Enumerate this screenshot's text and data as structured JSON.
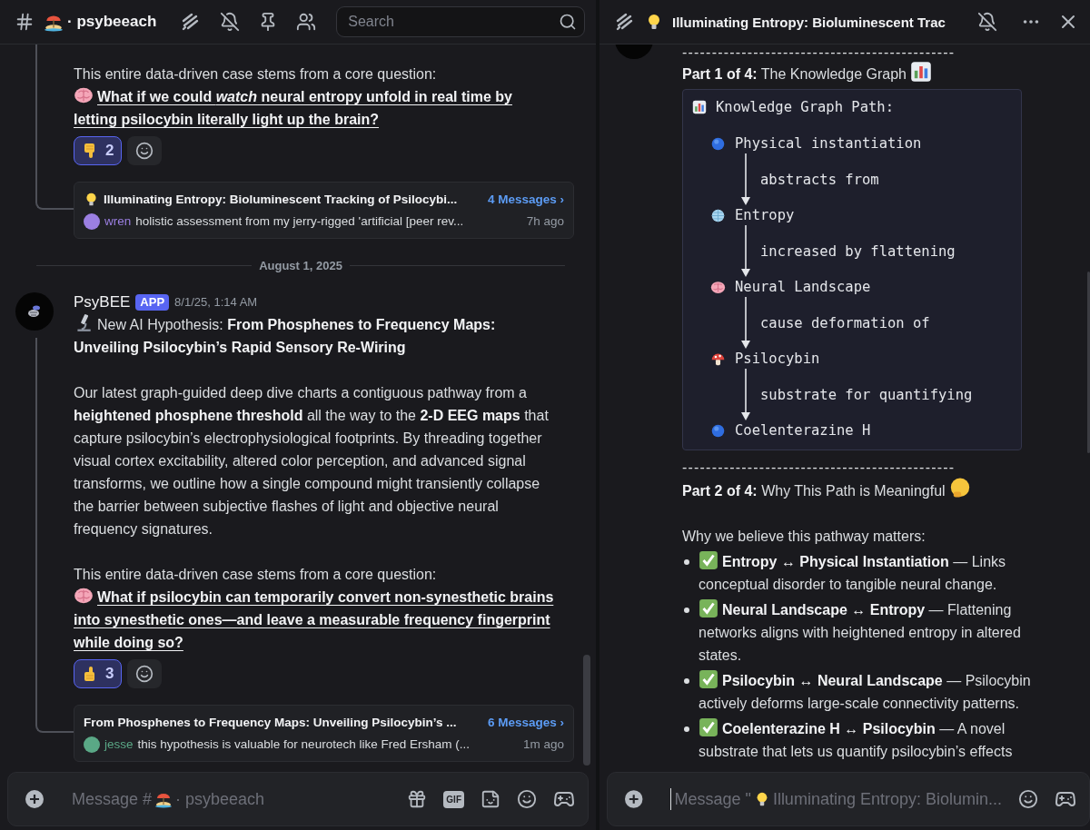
{
  "left": {
    "header": {
      "channel": "· psybeeach",
      "search": {
        "placeholder": "Search"
      }
    },
    "blocks": [
      {
        "kind": "continuation",
        "intro": "This entire data-driven case stems from a core question:",
        "question": "What if we could *watch* neural entropy unfold in real time by letting psilocybin literally light up the brain?",
        "reaction": {
          "kind": "thumbs_down",
          "count": "2",
          "selected": true
        },
        "thread": {
          "title": "Illuminating Entropy: Bioluminescent Tracking of Psilocybi...",
          "count": "4 Messages ›",
          "author": "wren",
          "color": "#9b7fe2",
          "preview": "holistic assessment from my jerry-rigged 'artificial [peer rev...",
          "time": "7h ago"
        }
      },
      {
        "kind": "divider",
        "label": "August 1, 2025"
      },
      {
        "kind": "message",
        "author": "PsyBEE",
        "tag": "APP",
        "time": "8/1/25, 1:14 AM",
        "headline": "New AI Hypothesis: **From Phosphenes to Frequency Maps: Unveiling Psilocybin’s Rapid Sensory Re-Wiring**",
        "body": "Our latest graph-guided deep dive charts a contiguous pathway from a **heightened phosphene threshold** all the way to the **2-D EEG maps** that capture psilocybin’s electrophysiological footprints. By threading together visual cortex excitability, altered color perception, and advanced signal transforms, we outline how a single compound might transiently collapse the barrier between subjective flashes of light and objective neural frequency signatures.",
        "intro": "This entire data-driven case stems from a core question:",
        "question": "What if psilocybin can temporarily convert non-synesthetic brains into synesthetic ones—and leave a measurable frequency fingerprint while doing so?",
        "reaction": {
          "kind": "thumbs_up",
          "count": "3",
          "selected": true
        },
        "thread": {
          "title": "From Phosphenes to Frequency Maps: Unveiling Psilocybin’s ...",
          "count": "6 Messages ›",
          "author": "jesse",
          "color": "#5aa886",
          "preview": "this hypothesis is valuable for neurotech like Fred Ersham (...",
          "time": "1m ago"
        }
      }
    ],
    "composer": {
      "prefix": "Message #",
      "suffix": "· psybeeach",
      "gif": "GIF"
    }
  },
  "right": {
    "header": {
      "title": "Illuminating Entropy: Bioluminescent Trac"
    },
    "content": [
      {
        "kind": "rule",
        "text": "----------------------------------------------"
      },
      {
        "kind": "heading",
        "text": "**Part 1 of 4:** The Knowledge Graph"
      },
      {
        "kind": "graph",
        "title": "Knowledge Graph Path:",
        "nodes": [
          {
            "kind": "blue_circle",
            "label": "Physical instantiation",
            "edge": "abstracts from"
          },
          {
            "kind": "globe",
            "label": "Entropy",
            "edge": "increased by flattening"
          },
          {
            "kind": "brain",
            "label": "Neural Landscape",
            "edge": "cause deformation of"
          },
          {
            "kind": "mushroom",
            "label": "Psilocybin",
            "edge": "substrate for quantifying"
          },
          {
            "kind": "blue_circle",
            "label": "Coelenterazine H"
          }
        ]
      },
      {
        "kind": "rule",
        "text": "----------------------------------------------"
      },
      {
        "kind": "heading",
        "text": "**Part 2 of 4:** Why This Path is Meaningful"
      },
      {
        "kind": "paragraph",
        "text": "Why we believe this pathway matters:"
      },
      {
        "kind": "bullets",
        "items": [
          {
            "text": "**Entropy ↔ Physical Instantiation** — Links conceptual disorder to tangible neural change."
          },
          {
            "text": "**Neural Landscape ↔ Entropy** — Flattening networks aligns with heightened entropy in altered states."
          },
          {
            "text": "**Psilocybin ↔ Neural Landscape** — Psilocybin actively deforms large-scale connectivity patterns."
          },
          {
            "text": "**Coelenterazine H ↔ Psilocybin** — A novel substrate that lets us quantify psilocybin’s effects"
          }
        ]
      }
    ],
    "composer": {
      "prefix": "Message \"",
      "title": "Illuminating Entropy: Biolumin..."
    }
  }
}
